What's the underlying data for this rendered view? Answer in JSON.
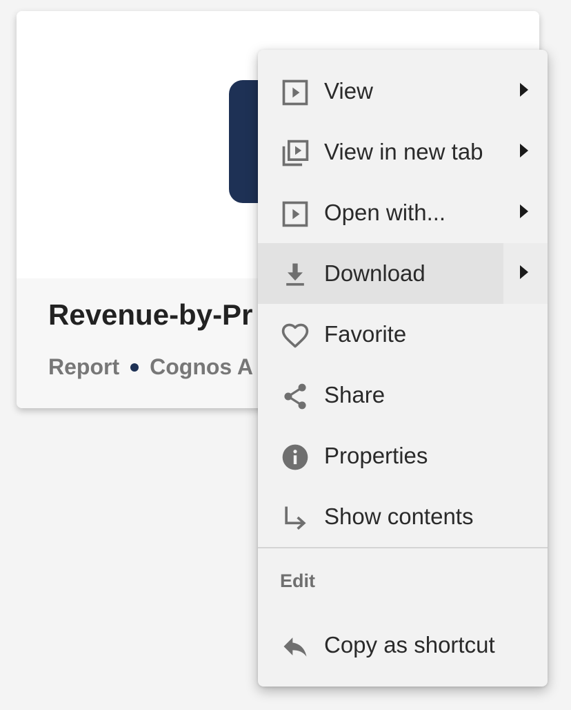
{
  "card": {
    "title": "Revenue-by-Pr",
    "type": "Report",
    "source": "Cognos A",
    "accent_color": "#1e3155"
  },
  "menu": {
    "items": [
      {
        "label": "View",
        "icon": "play-box-icon",
        "has_submenu": true
      },
      {
        "label": "View in new tab",
        "icon": "play-box-multiple-icon",
        "has_submenu": true
      },
      {
        "label": "Open with...",
        "icon": "play-box-icon",
        "has_submenu": true
      },
      {
        "label": "Download",
        "icon": "download-icon",
        "has_submenu": true,
        "hovered": true
      },
      {
        "label": "Favorite",
        "icon": "heart-outline-icon",
        "has_submenu": false
      },
      {
        "label": "Share",
        "icon": "share-icon",
        "has_submenu": false
      },
      {
        "label": "Properties",
        "icon": "info-icon",
        "has_submenu": false
      },
      {
        "label": "Show contents",
        "icon": "subdirectory-arrow-icon",
        "has_submenu": false
      }
    ],
    "section_label": "Edit",
    "edit_items": [
      {
        "label": "Copy as shortcut",
        "icon": "reply-icon",
        "has_submenu": false
      }
    ]
  },
  "colors": {
    "menu_background": "#f2f2f2",
    "hover_background": "#e2e2e2",
    "icon_color": "#6f6f6f",
    "text_color": "#2a2a2a"
  }
}
